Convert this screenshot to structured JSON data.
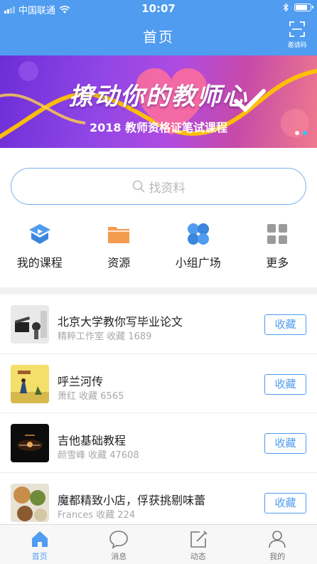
{
  "status_bar": {
    "carrier": "中国联通",
    "time": "10:07"
  },
  "nav": {
    "title": "首页",
    "invite_label": "邀请码"
  },
  "banner": {
    "title": "撩动你的教师心",
    "subtitle": "2018 教师资格证笔试课程",
    "page_count": 2,
    "active_page": 2
  },
  "search": {
    "placeholder": "找资料"
  },
  "quick_actions": [
    {
      "label": "我的课程",
      "icon": "course-icon"
    },
    {
      "label": "资源",
      "icon": "folder-icon"
    },
    {
      "label": "小组广场",
      "icon": "group-icon"
    },
    {
      "label": "更多",
      "icon": "more-grid-icon"
    }
  ],
  "list": [
    {
      "title": "北京大学教你写毕业论文",
      "author": "精粹工作室",
      "collect": "收藏 1689",
      "button": "收藏"
    },
    {
      "title": "呼兰河传",
      "author": "萧红",
      "collect": "收藏 6565",
      "button": "收藏"
    },
    {
      "title": "吉他基础教程",
      "author": "颜雪峰",
      "collect": "收藏 47608",
      "button": "收藏"
    },
    {
      "title": "魔都精致小店，俘获挑剔味蕾",
      "author": "Frances",
      "collect": "收藏 224",
      "button": "收藏"
    }
  ],
  "tabbar": [
    {
      "label": "首页",
      "icon": "home-icon",
      "active": true
    },
    {
      "label": "消息",
      "icon": "message-icon",
      "active": false
    },
    {
      "label": "动态",
      "icon": "edit-icon",
      "active": false
    },
    {
      "label": "我的",
      "icon": "profile-icon",
      "active": false
    }
  ],
  "colors": {
    "primary": "#4f9cf0",
    "folder": "#f49b4f",
    "grey_icon": "#9b9b9b"
  }
}
